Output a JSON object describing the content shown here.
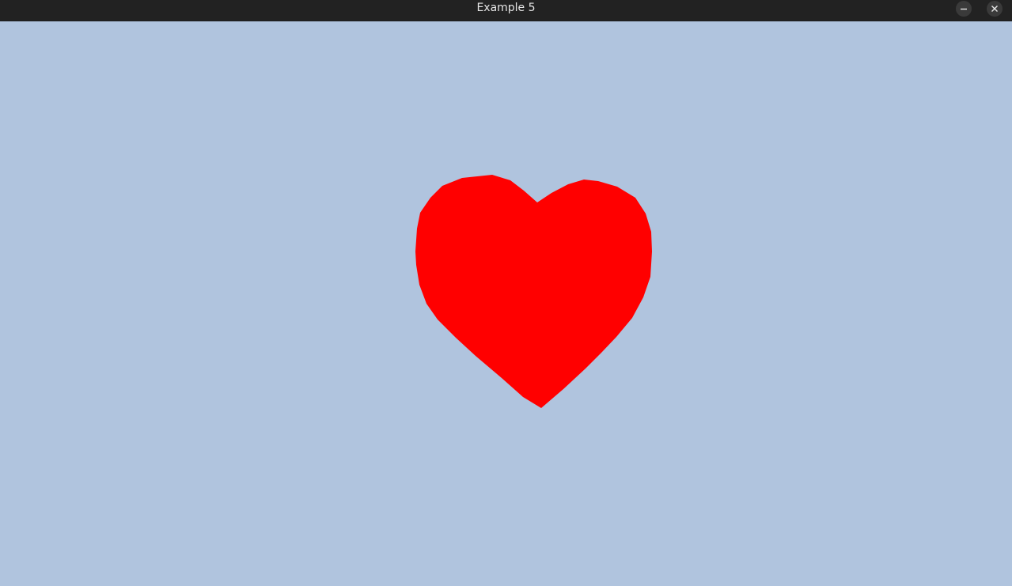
{
  "window": {
    "title": "Example 5",
    "background_color": "#b0c4de",
    "titlebar_color": "#222222",
    "controls": [
      "minimize-icon",
      "close-icon"
    ]
  },
  "scene": {
    "shape": "heart",
    "fill_color": "#ff0000"
  }
}
